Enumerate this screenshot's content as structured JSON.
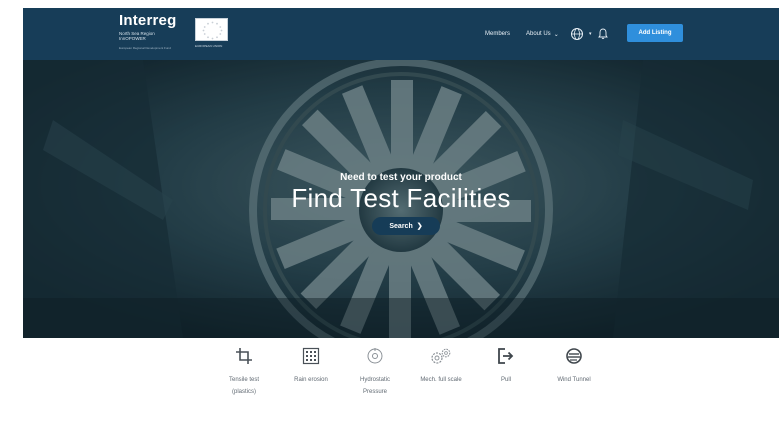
{
  "header": {
    "logo": {
      "title": "Interreg",
      "line1": "North Sea Region",
      "line2": "InnOPOWER",
      "line3": "European Regional Development Fund",
      "eu_caption": "EUROPEAN UNION"
    },
    "nav": {
      "members": "Members",
      "about": "About Us",
      "add_listing": "Add Listing"
    }
  },
  "hero": {
    "subtitle": "Need to test your product",
    "title": "Find Test Facilities",
    "search_label": "Search"
  },
  "categories": [
    {
      "icon": "crop-icon",
      "line1": "Tensile test",
      "line2": "(plastics)"
    },
    {
      "icon": "rain-erosion-icon",
      "line1": "Rain erosion",
      "line2": ""
    },
    {
      "icon": "pressure-icon",
      "line1": "Hydrostatic",
      "line2": "Pressure"
    },
    {
      "icon": "gears-icon",
      "line1": "Mech. full scale",
      "line2": ""
    },
    {
      "icon": "pull-icon",
      "line1": "Pull",
      "line2": ""
    },
    {
      "icon": "wind-tunnel-icon",
      "line1": "Wind Tunnel",
      "line2": ""
    }
  ],
  "colors": {
    "header_bg": "#173d58",
    "accent": "#2f8fdc",
    "search_bg": "#163c57"
  }
}
